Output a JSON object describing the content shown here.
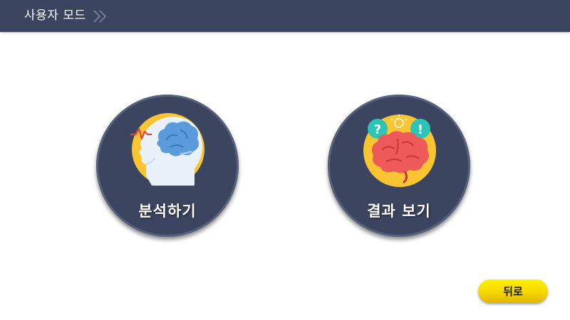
{
  "header": {
    "title": "사용자 모드",
    "icon": "double-chevron-right-icon"
  },
  "main": {
    "analyze_button": {
      "label": "분석하기",
      "icon": "head-brain-icon"
    },
    "results_button": {
      "label": "결과 보기",
      "icon": "brain-idea-icon"
    }
  },
  "back_button": {
    "label": "뒤로"
  },
  "colors": {
    "header_bg": "#3b4560",
    "button_bg": "#3b4560",
    "back_button": "#f5d700",
    "icon_circle": "#fbc531"
  }
}
